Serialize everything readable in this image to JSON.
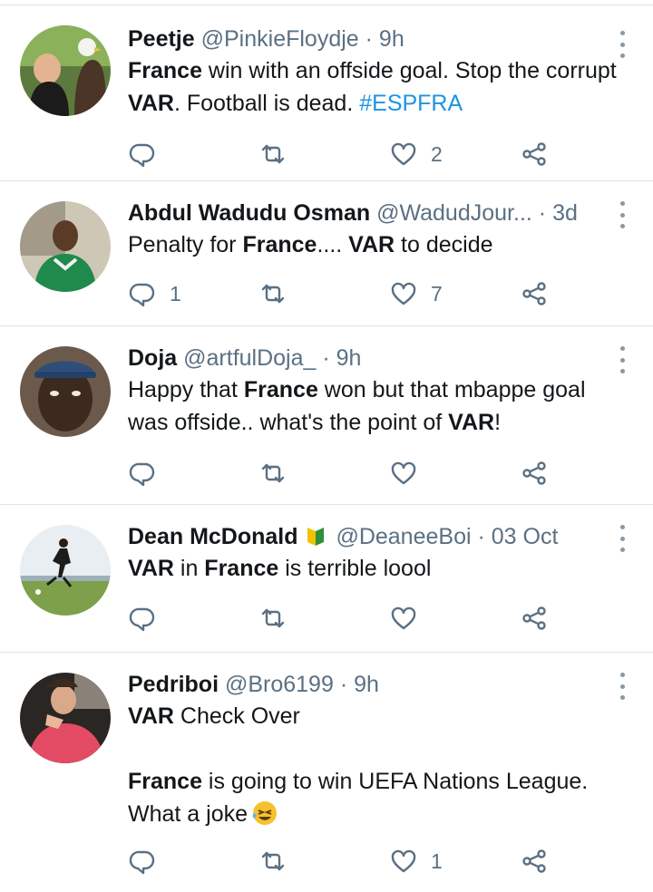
{
  "colors": {
    "accent": "#1b95e0",
    "muted": "#5b7083",
    "text": "#14171a",
    "divider": "#dfe3e6"
  },
  "tweets": [
    {
      "name": "Peetje",
      "handle": "@PinkieFloydje",
      "dot": "·",
      "time": "9h",
      "t1": "France",
      "t2": " win with an offside goal. Stop the corrupt ",
      "t3": "VAR",
      "t4": ". Football is dead. ",
      "hashtag": "#ESPFRA",
      "replies": "",
      "likes": "2"
    },
    {
      "name": "Abdul Wadudu Osman",
      "handle": "@WadudJour...",
      "dot": "·",
      "time": "3d",
      "t1": "Penalty for ",
      "t2": "France",
      "t3": ".... ",
      "t4": "VAR",
      "t5": " to decide",
      "replies": "1",
      "likes": "7"
    },
    {
      "name": "Doja",
      "handle": "@artfulDoja_",
      "dot": "·",
      "time": "9h",
      "t1": "Happy that ",
      "t2": "France",
      "t3": " won but that mbappe goal was offside.. what's the point of ",
      "t4": "VAR",
      "t5": "!",
      "replies": "",
      "likes": ""
    },
    {
      "name": "Dean McDonald",
      "badge_icon": "beginner-badge-icon",
      "handle": "@DeaneeBoi",
      "dot": "·",
      "time": "03 Oct",
      "t1": "VAR",
      "t2": " in ",
      "t3": "France",
      "t4": " is terrible loool",
      "replies": "",
      "likes": ""
    },
    {
      "name": "Pedriboi",
      "handle": "@Bro6199",
      "dot": "·",
      "time": "9h",
      "t1": "VAR",
      "t2": " Check Over",
      "t3": "France",
      "t4": " is going to win UEFA Nations League. What a joke",
      "emoji_icon": "rolling-laughing-emoji-icon",
      "replies": "",
      "likes": "1"
    }
  ]
}
